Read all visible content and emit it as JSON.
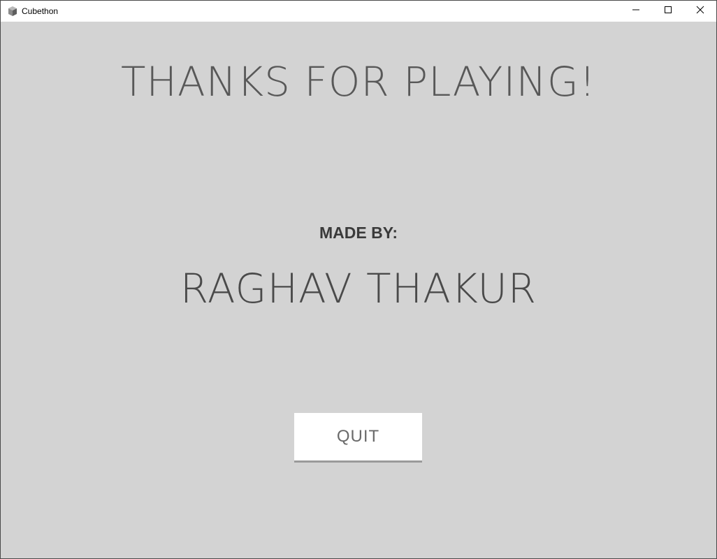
{
  "window": {
    "title": "Cubethon",
    "icon": "cube-icon",
    "controls": [
      "minimize-icon",
      "maximize-icon",
      "close-icon"
    ]
  },
  "screen": {
    "heading": "THANKS FOR PLAYING!",
    "made_by_label": "MADE BY:",
    "author": "RAGHAV THAKUR",
    "quit_label": "QUIT"
  },
  "colors": {
    "background": "#d3d3d3",
    "button_background": "#ffffff",
    "button_text": "#6a6a6a",
    "heading_text": "#585858"
  }
}
